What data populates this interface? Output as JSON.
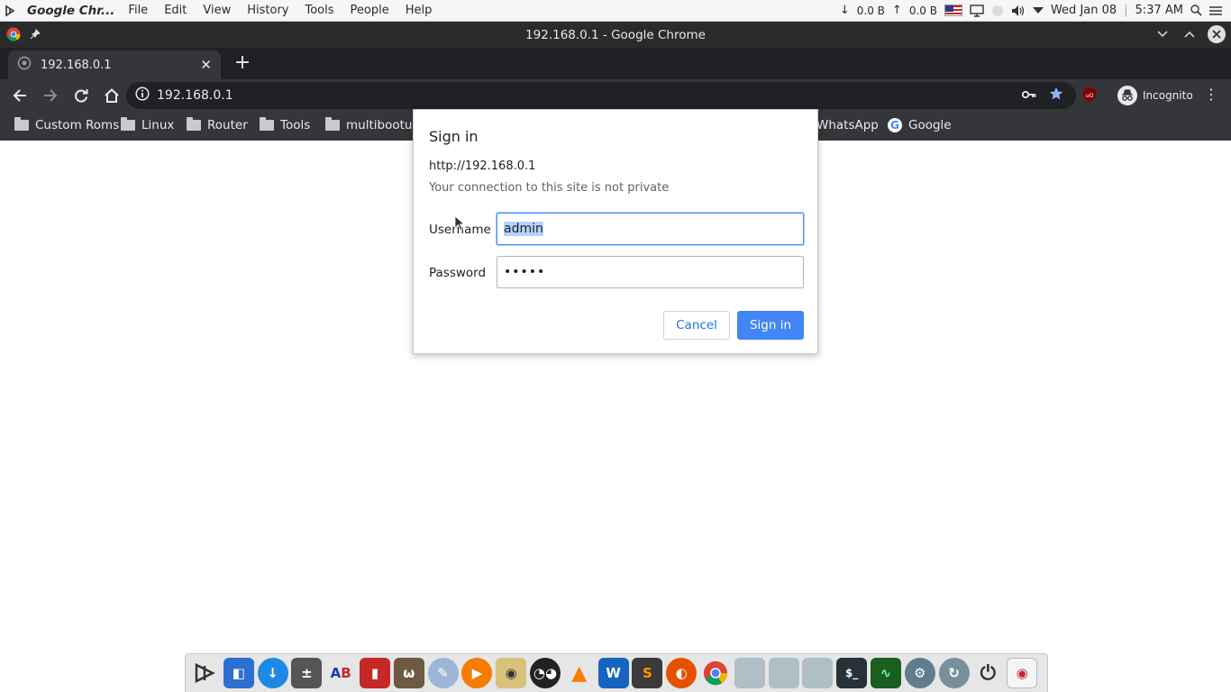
{
  "menubar": {
    "app_name": "Google Chr...",
    "menus": [
      "File",
      "Edit",
      "View",
      "History",
      "Tools",
      "People",
      "Help"
    ],
    "net_down": "0.0 B",
    "net_up": "0.0 B",
    "datetime": "Wed Jan 08",
    "time": "5:37 AM"
  },
  "window": {
    "title": "192.168.0.1 - Google Chrome"
  },
  "tab": {
    "title": "192.168.0.1"
  },
  "toolbar": {
    "url": "192.168.0.1",
    "profile_label": "Incognito"
  },
  "bookmarks": [
    {
      "label": "Custom Roms",
      "icon": "folder-icon"
    },
    {
      "label": "Linux",
      "icon": "folder-icon"
    },
    {
      "label": "Router",
      "icon": "folder-icon"
    },
    {
      "label": "Tools",
      "icon": "folder-icon"
    },
    {
      "label": "multibootusb",
      "icon": "folder-icon"
    },
    {
      "label": "WhatsApp",
      "icon": "none"
    },
    {
      "label": "Google",
      "icon": "google-icon"
    }
  ],
  "dialog": {
    "title": "Sign in",
    "origin": "http://192.168.0.1",
    "warning": "Your connection to this site is not private",
    "username_label": "Username",
    "username_value": "admin",
    "password_label": "Password",
    "password_value": "•••••",
    "cancel_label": "Cancel",
    "signin_label": "Sign in"
  },
  "dock": {
    "icons": [
      "launcher-icon",
      "finder-icon",
      "downloads-icon",
      "calculator-icon",
      "dictionary-icon",
      "archive-icon",
      "gimp-icon",
      "inkscape-icon",
      "media-player-icon",
      "rhythmbox-icon",
      "owl-icon",
      "vlc-icon",
      "wavelet-icon",
      "sublime-text-icon",
      "firefox-icon",
      "chrome-icon",
      "files-icon",
      "files-icon",
      "files-icon",
      "terminal-icon",
      "system-monitor-icon",
      "settings-icon",
      "update-icon",
      "power-icon",
      "trash-icon"
    ]
  },
  "colors": {
    "accent": "#4285f4",
    "chrome_dark": "#35363a",
    "tab_strip": "#202124"
  }
}
